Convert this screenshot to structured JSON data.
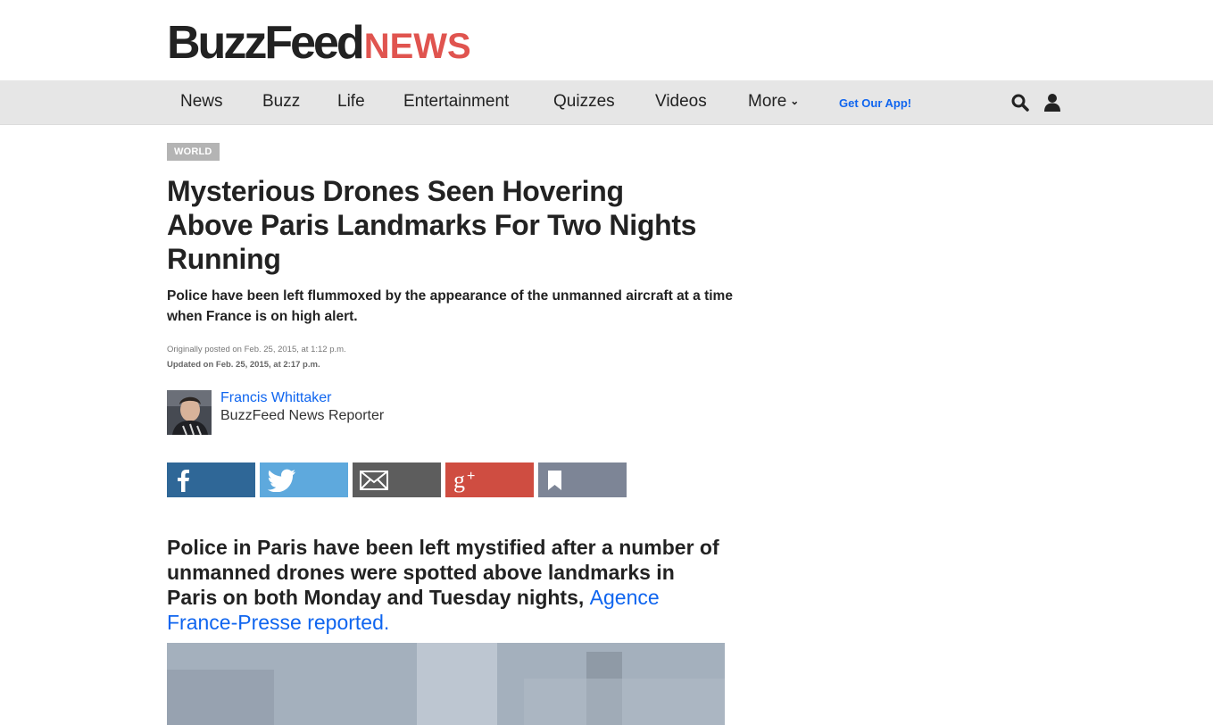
{
  "logo": {
    "brand": "BuzzFeed",
    "section": "NEWS"
  },
  "nav": {
    "items": [
      "News",
      "Buzz",
      "Life",
      "Entertainment",
      "Quizzes",
      "Videos"
    ],
    "more_label": "More",
    "app_link": "Get Our App!",
    "icons": [
      "search-icon",
      "user-icon"
    ]
  },
  "article": {
    "section_tag": "WORLD",
    "headline": "Mysterious Drones Seen Hovering Above Paris Landmarks For Two Nights Running",
    "dek": "Police have been left flummoxed by the appearance of the unmanned aircraft at a time when France is on high alert.",
    "posted": "Originally posted on Feb. 25, 2015, at 1:12 p.m.",
    "updated": "Updated on Feb. 25, 2015, at 2:17 p.m.",
    "author": {
      "name": "Francis Whittaker",
      "role": "BuzzFeed News Reporter"
    },
    "lead_text": "Police in Paris have been left mystified after a number of unmanned drones were spotted above landmarks in Paris on both Monday and Tuesday nights, ",
    "lead_link": "Agence France-Presse reported."
  },
  "share": [
    {
      "name": "facebook",
      "icon": "facebook-icon",
      "color": "#2f6797"
    },
    {
      "name": "twitter",
      "icon": "twitter-icon",
      "color": "#5ea9dd"
    },
    {
      "name": "email",
      "icon": "email-icon",
      "color": "#5d5d5d"
    },
    {
      "name": "google-plus",
      "icon": "google-plus-icon",
      "color": "#cf4d41"
    },
    {
      "name": "bookmark",
      "icon": "bookmark-icon",
      "color": "#7d8596"
    }
  ],
  "colors": {
    "accent_red": "#e0544f",
    "link_blue": "#0f65ef",
    "nav_bg": "#e6e6e6"
  }
}
